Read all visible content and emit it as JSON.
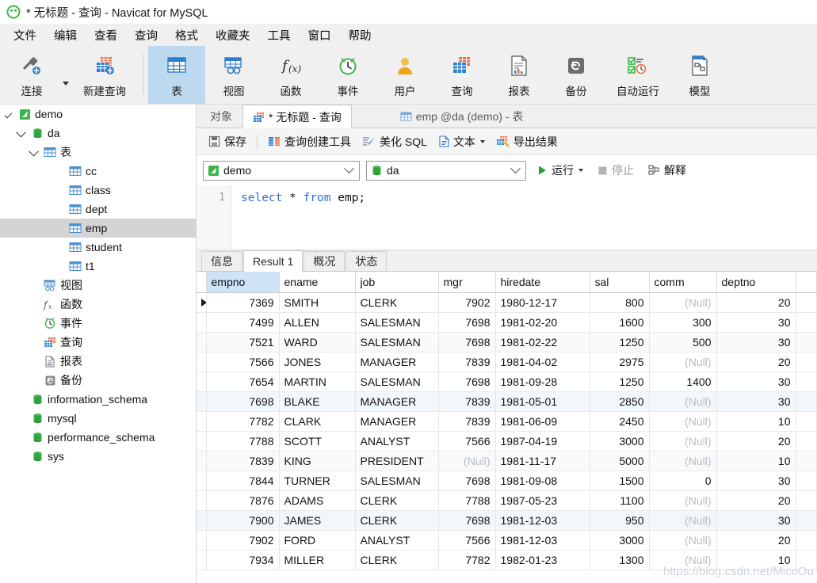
{
  "window": {
    "title": "* 无标题 - 查询 - Navicat for MySQL",
    "app_icon": "navicat-logo-icon"
  },
  "menubar": {
    "items": [
      {
        "label": "文件",
        "name": "menu-file"
      },
      {
        "label": "编辑",
        "name": "menu-edit"
      },
      {
        "label": "查看",
        "name": "menu-view"
      },
      {
        "label": "查询",
        "name": "menu-query"
      },
      {
        "label": "格式",
        "name": "menu-format"
      },
      {
        "label": "收藏夹",
        "name": "menu-favorites"
      },
      {
        "label": "工具",
        "name": "menu-tools"
      },
      {
        "label": "窗口",
        "name": "menu-window"
      },
      {
        "label": "帮助",
        "name": "menu-help"
      }
    ]
  },
  "toolbar": {
    "items": [
      {
        "label": "连接",
        "icon": "connection-plug-icon",
        "active": false
      },
      {
        "label": "新建查询",
        "icon": "new-query-icon",
        "active": false
      },
      {
        "label": "表",
        "icon": "table-icon",
        "active": true
      },
      {
        "label": "视图",
        "icon": "view-icon",
        "active": false
      },
      {
        "label": "函数",
        "icon": "function-fx-icon",
        "active": false
      },
      {
        "label": "事件",
        "icon": "event-clock-icon",
        "active": false
      },
      {
        "label": "用户",
        "icon": "user-icon",
        "active": false
      },
      {
        "label": "查询",
        "icon": "query-icon",
        "active": false
      },
      {
        "label": "报表",
        "icon": "report-icon",
        "active": false
      },
      {
        "label": "备份",
        "icon": "backup-icon",
        "active": false
      },
      {
        "label": "自动运行",
        "icon": "automation-icon",
        "active": false
      },
      {
        "label": "模型",
        "icon": "model-icon",
        "active": false
      }
    ]
  },
  "sidebar": {
    "nodes": [
      {
        "label": "demo",
        "indent": 0,
        "icon": "connection-icon",
        "toggle": "check",
        "selected": false
      },
      {
        "label": "da",
        "indent": 1,
        "icon": "database-icon",
        "toggle": "chevron",
        "selected": false
      },
      {
        "label": "表",
        "indent": 2,
        "icon": "table-icon",
        "toggle": "chevron",
        "selected": false
      },
      {
        "label": "cc",
        "indent": 4,
        "icon": "table-icon",
        "toggle": "none",
        "selected": false
      },
      {
        "label": "class",
        "indent": 4,
        "icon": "table-icon",
        "toggle": "none",
        "selected": false
      },
      {
        "label": "dept",
        "indent": 4,
        "icon": "table-icon",
        "toggle": "none",
        "selected": false
      },
      {
        "label": "emp",
        "indent": 4,
        "icon": "table-icon",
        "toggle": "none",
        "selected": true
      },
      {
        "label": "student",
        "indent": 4,
        "icon": "table-icon",
        "toggle": "none",
        "selected": false
      },
      {
        "label": "t1",
        "indent": 4,
        "icon": "table-icon",
        "toggle": "none",
        "selected": false
      },
      {
        "label": "视图",
        "indent": 2,
        "icon": "view-icon",
        "toggle": "none",
        "selected": false
      },
      {
        "label": "函数",
        "indent": 2,
        "icon": "function-fx-icon",
        "toggle": "none",
        "selected": false
      },
      {
        "label": "事件",
        "indent": 2,
        "icon": "event-clock-icon",
        "toggle": "none",
        "selected": false
      },
      {
        "label": "查询",
        "indent": 2,
        "icon": "query-icon",
        "toggle": "none",
        "selected": false
      },
      {
        "label": "报表",
        "indent": 2,
        "icon": "report-icon",
        "toggle": "none",
        "selected": false
      },
      {
        "label": "备份",
        "indent": 2,
        "icon": "backup-icon",
        "toggle": "none",
        "selected": false
      },
      {
        "label": "information_schema",
        "indent": 1,
        "icon": "database-icon",
        "toggle": "none",
        "selected": false
      },
      {
        "label": "mysql",
        "indent": 1,
        "icon": "database-icon",
        "toggle": "none",
        "selected": false
      },
      {
        "label": "performance_schema",
        "indent": 1,
        "icon": "database-icon",
        "toggle": "none",
        "selected": false
      },
      {
        "label": "sys",
        "indent": 1,
        "icon": "database-icon",
        "toggle": "none",
        "selected": false
      }
    ]
  },
  "tabs": [
    {
      "label": "对象",
      "icon": "none",
      "active": false,
      "name": "tab-objects"
    },
    {
      "label": "* 无标题 - 查询",
      "icon": "query-icon",
      "active": true,
      "name": "tab-untitled-query"
    },
    {
      "label": "emp @da (demo) - 表",
      "icon": "table-icon",
      "active": false,
      "name": "tab-emp-table"
    }
  ],
  "query_toolbar": {
    "buttons": [
      {
        "label": "保存",
        "icon": "save-icon",
        "name": "save-button",
        "caret": false
      },
      {
        "label": "查询创建工具",
        "icon": "query-builder-icon",
        "name": "query-builder-button",
        "caret": false
      },
      {
        "label": "美化 SQL",
        "icon": "beautify-sql-icon",
        "name": "beautify-sql-button",
        "caret": false
      },
      {
        "label": "文本",
        "icon": "text-icon",
        "name": "text-button",
        "caret": true
      },
      {
        "label": "导出结果",
        "icon": "export-result-icon",
        "name": "export-result-button",
        "caret": false
      }
    ]
  },
  "selector_bar": {
    "connection": {
      "value": "demo",
      "icon": "connection-icon"
    },
    "database": {
      "value": "da",
      "icon": "database-icon"
    },
    "run_label": "运行",
    "stop_label": "停止",
    "explain_label": "解释"
  },
  "editor": {
    "line_number": "1",
    "sql_tokens": [
      {
        "text": "select",
        "type": "kw"
      },
      {
        "text": " * ",
        "type": "op"
      },
      {
        "text": "from",
        "type": "kw"
      },
      {
        "text": " emp;",
        "type": "op"
      }
    ],
    "sql_full": "select * from emp;"
  },
  "result_tabs": [
    {
      "label": "信息",
      "active": false,
      "name": "result-tab-info"
    },
    {
      "label": "Result 1",
      "active": true,
      "name": "result-tab-result1"
    },
    {
      "label": "概况",
      "active": false,
      "name": "result-tab-profile"
    },
    {
      "label": "状态",
      "active": false,
      "name": "result-tab-status"
    }
  ],
  "grid": {
    "columns": [
      "empno",
      "ename",
      "job",
      "mgr",
      "hiredate",
      "sal",
      "comm",
      "deptno"
    ],
    "selected_column": "empno",
    "null_text": "(Null)",
    "rows": [
      {
        "empno": "7369",
        "ename": "SMITH",
        "job": "CLERK",
        "mgr": "7902",
        "hiredate": "1980-12-17",
        "sal": "800",
        "comm": "(Null)",
        "deptno": "20"
      },
      {
        "empno": "7499",
        "ename": "ALLEN",
        "job": "SALESMAN",
        "mgr": "7698",
        "hiredate": "1981-02-20",
        "sal": "1600",
        "comm": "300",
        "deptno": "30"
      },
      {
        "empno": "7521",
        "ename": "WARD",
        "job": "SALESMAN",
        "mgr": "7698",
        "hiredate": "1981-02-22",
        "sal": "1250",
        "comm": "500",
        "deptno": "30"
      },
      {
        "empno": "7566",
        "ename": "JONES",
        "job": "MANAGER",
        "mgr": "7839",
        "hiredate": "1981-04-02",
        "sal": "2975",
        "comm": "(Null)",
        "deptno": "20"
      },
      {
        "empno": "7654",
        "ename": "MARTIN",
        "job": "SALESMAN",
        "mgr": "7698",
        "hiredate": "1981-09-28",
        "sal": "1250",
        "comm": "1400",
        "deptno": "30"
      },
      {
        "empno": "7698",
        "ename": "BLAKE",
        "job": "MANAGER",
        "mgr": "7839",
        "hiredate": "1981-05-01",
        "sal": "2850",
        "comm": "(Null)",
        "deptno": "30"
      },
      {
        "empno": "7782",
        "ename": "CLARK",
        "job": "MANAGER",
        "mgr": "7839",
        "hiredate": "1981-06-09",
        "sal": "2450",
        "comm": "(Null)",
        "deptno": "10"
      },
      {
        "empno": "7788",
        "ename": "SCOTT",
        "job": "ANALYST",
        "mgr": "7566",
        "hiredate": "1987-04-19",
        "sal": "3000",
        "comm": "(Null)",
        "deptno": "20"
      },
      {
        "empno": "7839",
        "ename": "KING",
        "job": "PRESIDENT",
        "mgr": "(Null)",
        "hiredate": "1981-11-17",
        "sal": "5000",
        "comm": "(Null)",
        "deptno": "10"
      },
      {
        "empno": "7844",
        "ename": "TURNER",
        "job": "SALESMAN",
        "mgr": "7698",
        "hiredate": "1981-09-08",
        "sal": "1500",
        "comm": "0",
        "deptno": "30"
      },
      {
        "empno": "7876",
        "ename": "ADAMS",
        "job": "CLERK",
        "mgr": "7788",
        "hiredate": "1987-05-23",
        "sal": "1100",
        "comm": "(Null)",
        "deptno": "20"
      },
      {
        "empno": "7900",
        "ename": "JAMES",
        "job": "CLERK",
        "mgr": "7698",
        "hiredate": "1981-12-03",
        "sal": "950",
        "comm": "(Null)",
        "deptno": "30"
      },
      {
        "empno": "7902",
        "ename": "FORD",
        "job": "ANALYST",
        "mgr": "7566",
        "hiredate": "1981-12-03",
        "sal": "3000",
        "comm": "(Null)",
        "deptno": "20"
      },
      {
        "empno": "7934",
        "ename": "MILLER",
        "job": "CLERK",
        "mgr": "7782",
        "hiredate": "1982-01-23",
        "sal": "1300",
        "comm": "(Null)",
        "deptno": "10"
      }
    ],
    "current_row_index": 0
  },
  "watermark": "https://blog.csdn.net/MicoOu",
  "colors": {
    "accent_blue": "#2f7fd0",
    "active_tab_blue": "#bdd9f0",
    "selection_gray": "#d4d4d4",
    "header_select": "#cfe3f7",
    "null_gray": "#b6bcc6",
    "green_run": "#2aa02a"
  }
}
